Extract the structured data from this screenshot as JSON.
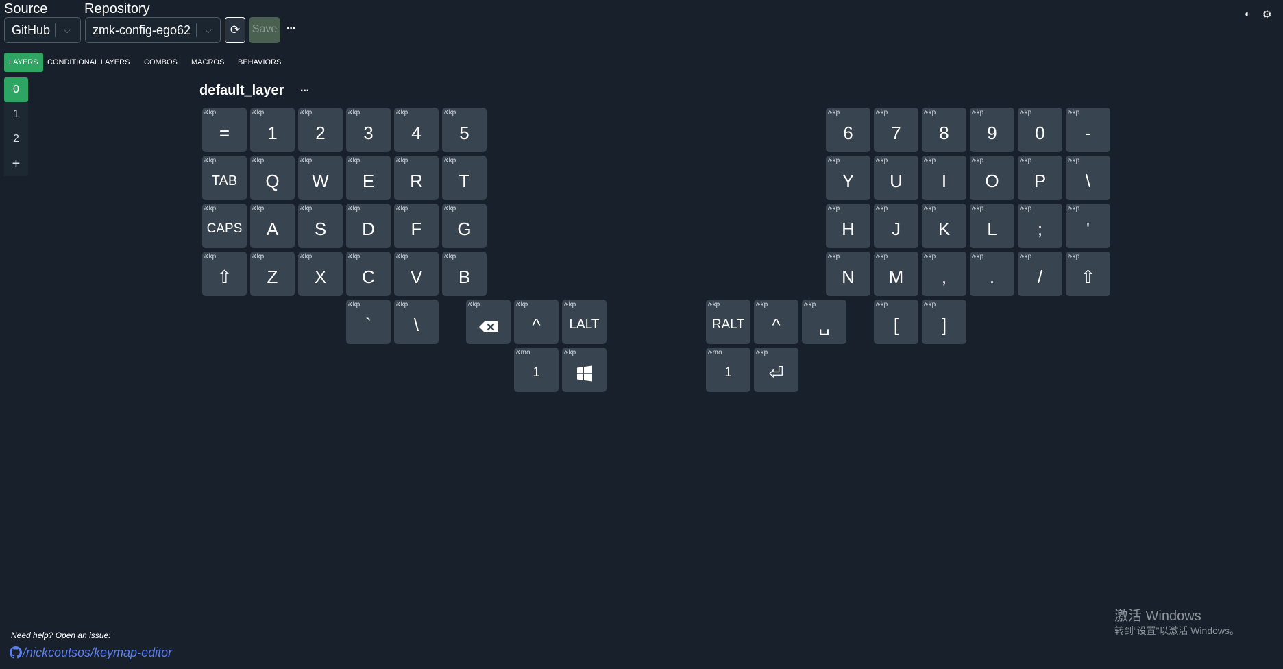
{
  "header": {
    "source_label": "Source",
    "repository_label": "Repository",
    "source_value": "GitHub",
    "repository_value": "zmk-config-ego62",
    "save_label": "Save",
    "more_label": "···"
  },
  "tabs": [
    "LAYERS",
    "CONDITIONAL LAYERS",
    "COMBOS",
    "MACROS",
    "BEHAVIORS"
  ],
  "layers": [
    "0",
    "1",
    "2"
  ],
  "add_layer_label": "+",
  "layer": {
    "name": "default_layer",
    "menu_label": "···"
  },
  "keys": [
    {
      "b": "&kp",
      "l": "="
    },
    {
      "b": "&kp",
      "l": "1"
    },
    {
      "b": "&kp",
      "l": "2"
    },
    {
      "b": "&kp",
      "l": "3"
    },
    {
      "b": "&kp",
      "l": "4"
    },
    {
      "b": "&kp",
      "l": "5"
    },
    {
      "b": "&kp",
      "l": "6"
    },
    {
      "b": "&kp",
      "l": "7"
    },
    {
      "b": "&kp",
      "l": "8"
    },
    {
      "b": "&kp",
      "l": "9"
    },
    {
      "b": "&kp",
      "l": "0"
    },
    {
      "b": "&kp",
      "l": "-"
    },
    {
      "b": "&kp",
      "l": "TAB"
    },
    {
      "b": "&kp",
      "l": "Q"
    },
    {
      "b": "&kp",
      "l": "W"
    },
    {
      "b": "&kp",
      "l": "E"
    },
    {
      "b": "&kp",
      "l": "R"
    },
    {
      "b": "&kp",
      "l": "T"
    },
    {
      "b": "&kp",
      "l": "Y"
    },
    {
      "b": "&kp",
      "l": "U"
    },
    {
      "b": "&kp",
      "l": "I"
    },
    {
      "b": "&kp",
      "l": "O"
    },
    {
      "b": "&kp",
      "l": "P"
    },
    {
      "b": "&kp",
      "l": "\\"
    },
    {
      "b": "&kp",
      "l": "CAPS"
    },
    {
      "b": "&kp",
      "l": "A"
    },
    {
      "b": "&kp",
      "l": "S"
    },
    {
      "b": "&kp",
      "l": "D"
    },
    {
      "b": "&kp",
      "l": "F"
    },
    {
      "b": "&kp",
      "l": "G"
    },
    {
      "b": "&kp",
      "l": "H"
    },
    {
      "b": "&kp",
      "l": "J"
    },
    {
      "b": "&kp",
      "l": "K"
    },
    {
      "b": "&kp",
      "l": "L"
    },
    {
      "b": "&kp",
      "l": ";"
    },
    {
      "b": "&kp",
      "l": "'"
    },
    {
      "b": "&kp",
      "l": "⇧"
    },
    {
      "b": "&kp",
      "l": "Z"
    },
    {
      "b": "&kp",
      "l": "X"
    },
    {
      "b": "&kp",
      "l": "C"
    },
    {
      "b": "&kp",
      "l": "V"
    },
    {
      "b": "&kp",
      "l": "B"
    },
    {
      "b": "&kp",
      "l": "N"
    },
    {
      "b": "&kp",
      "l": "M"
    },
    {
      "b": "&kp",
      "l": ","
    },
    {
      "b": "&kp",
      "l": "."
    },
    {
      "b": "&kp",
      "l": "/"
    },
    {
      "b": "&kp",
      "l": "⇧"
    },
    {
      "b": "&kp",
      "l": "`"
    },
    {
      "b": "&kp",
      "l": "\\"
    },
    {
      "b": "&kp",
      "l": "",
      "icon": "backspace-icon"
    },
    {
      "b": "&kp",
      "l": "^"
    },
    {
      "b": "&kp",
      "l": "LALT"
    },
    {
      "b": "&kp",
      "l": "RALT"
    },
    {
      "b": "&kp",
      "l": "^"
    },
    {
      "b": "&kp",
      "l": "␣"
    },
    {
      "b": "&kp",
      "l": "["
    },
    {
      "b": "&kp",
      "l": "]"
    },
    {
      "b": "&mo",
      "l": "1"
    },
    {
      "b": "&kp",
      "l": "",
      "icon": "windows-icon"
    },
    {
      "b": "&mo",
      "l": "1"
    },
    {
      "b": "&kp",
      "l": "⏎"
    }
  ],
  "footer": {
    "help_text": "Need help? Open an issue:",
    "repo_link": "/nickcoutsos/keymap-editor"
  },
  "watermark": {
    "title": "激活 Windows",
    "subtitle": "转到“设置”以激活 Windows。"
  },
  "colors": {
    "background": "#17202b",
    "key": "#384450",
    "accent": "#2fa563",
    "link": "#5d7ff0"
  }
}
